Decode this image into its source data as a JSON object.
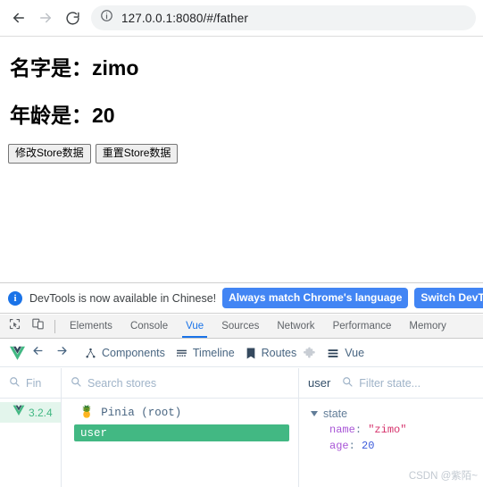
{
  "browser": {
    "back_icon": "arrow-left-icon",
    "forward_icon": "arrow-right-icon",
    "reload_icon": "reload-icon",
    "site_info_icon": "info-circle-icon",
    "url": "127.0.0.1:8080/#/father"
  },
  "page": {
    "name_heading": "名字是：zimo",
    "age_heading": "年龄是：20",
    "buttons": [
      {
        "label": "修改Store数据",
        "name": "modify-store-button"
      },
      {
        "label": "重置Store数据",
        "name": "reset-store-button"
      }
    ]
  },
  "devtools_notice": {
    "icon": "info-icon",
    "message": "DevTools is now available in Chinese!",
    "primary_button": "Always match Chrome's language",
    "secondary_button": "Switch DevTools to C"
  },
  "devtools": {
    "inspect_icon": "inspect-cursor-icon",
    "device_icon": "device-toggle-icon",
    "tabs": [
      {
        "label": "Elements",
        "active": false
      },
      {
        "label": "Console",
        "active": false
      },
      {
        "label": "Vue",
        "active": true
      },
      {
        "label": "Sources",
        "active": false
      },
      {
        "label": "Network",
        "active": false
      },
      {
        "label": "Performance",
        "active": false
      },
      {
        "label": "Memory",
        "active": false
      }
    ],
    "active_tab_color": "#1a73e8"
  },
  "vue_toolbar": {
    "logo_icon": "vue-logo-icon",
    "back_icon": "arrow-left-icon",
    "forward_icon": "arrow-right-icon",
    "items": [
      {
        "label": "Components",
        "icon": "component-tree-icon"
      },
      {
        "label": "Timeline",
        "icon": "timeline-icon"
      },
      {
        "label": "Routes",
        "icon": "book-icon"
      }
    ],
    "puzzle_icon": "puzzle-piece-icon",
    "last_item": {
      "label": "Vue",
      "icon": "list-rows-icon"
    },
    "accent_color": "#42b883"
  },
  "vue_panel": {
    "find_placeholder": "Fin",
    "find_icon": "search-icon",
    "stores_search_placeholder": "Search stores",
    "stores_search_icon": "search-icon",
    "selected_store_name": "user",
    "filter_state_placeholder": "Filter state...",
    "filter_state_icon": "search-icon",
    "vue_version": "3.2.4",
    "version_icon": "vue-logo-icon",
    "store_root": {
      "emoji": "🍍",
      "label": "Pinia (root)"
    },
    "store_items": [
      {
        "label": "user",
        "selected": true
      }
    ],
    "state": {
      "section_label": "state",
      "expanded": true,
      "entries": [
        {
          "key": "name",
          "value": "\"zimo\"",
          "type": "string"
        },
        {
          "key": "age",
          "value": "20",
          "type": "number"
        }
      ]
    },
    "highlight_color": "#42b883"
  },
  "watermark": "CSDN @紫陌~"
}
